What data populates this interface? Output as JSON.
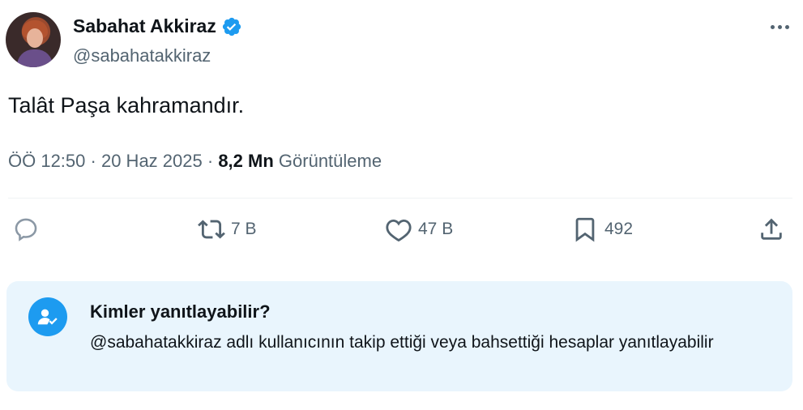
{
  "author": {
    "display_name": "Sabahat Akkiraz",
    "handle": "@sabahatakkiraz",
    "verified": true
  },
  "tweet": {
    "text": "Talât Paşa kahramandır.",
    "time": "ÖÖ 12:50",
    "separator": "·",
    "date": "20 Haz 2025",
    "views_count": "8,2 Mn",
    "views_label": "Görüntüleme"
  },
  "actions": {
    "replies": "",
    "retweets": "7 B",
    "likes": "47 B",
    "bookmarks": "492"
  },
  "reply_restriction": {
    "title": "Kimler yanıtlayabilir?",
    "description": "@sabahatakkiraz adlı kullanıcının takip ettiği veya bahsettiği hesaplar yanıtlayabilir"
  },
  "colors": {
    "accent": "#1d9bf0",
    "secondary_text": "#536471",
    "primary_text": "#0f1419",
    "info_box_bg": "#e9f5fd"
  },
  "icons": {
    "more": "more-horizontal-icon",
    "reply": "reply-icon",
    "retweet": "retweet-icon",
    "like": "heart-icon",
    "bookmark": "bookmark-icon",
    "share": "share-icon",
    "verified": "verified-badge-icon",
    "mention": "person-mention-icon"
  }
}
